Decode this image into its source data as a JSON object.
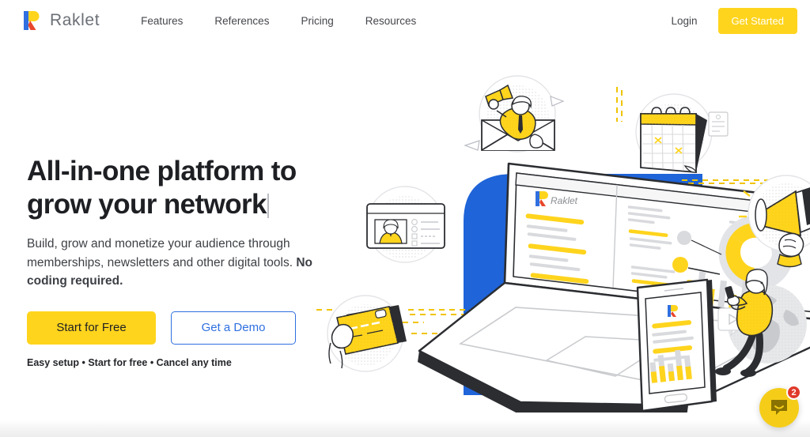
{
  "header": {
    "logo_name": "raklet-logo-icon",
    "brand": "Raklet",
    "nav": [
      {
        "label": "Features"
      },
      {
        "label": "References"
      },
      {
        "label": "Pricing"
      },
      {
        "label": "Resources"
      }
    ],
    "login": "Login",
    "get_started": "Get Started"
  },
  "hero": {
    "headline_line1": "All-in-one platform to",
    "headline_line2": "grow your  network",
    "subhead_part1": "Build, grow and monetize your audience through memberships, newsletters and other digital tools. ",
    "subhead_bold": "No coding required.",
    "cta_primary": "Start for Free",
    "cta_secondary": "Get a Demo",
    "fineprint": "Easy setup • Start for free • Cancel any time"
  },
  "illustration": {
    "alt": "Laptop and tablet showing Raklet dashboard surrounded by feature icons",
    "device_brand": "Raklet",
    "icons": [
      {
        "name": "envelope-megaphone-icon",
        "label": "Email campaigns"
      },
      {
        "name": "calendar-icon",
        "label": "Events calendar"
      },
      {
        "name": "member-card-icon",
        "label": "Member profiles"
      },
      {
        "name": "credit-card-icon",
        "label": "Payments"
      },
      {
        "name": "megaphone-icon",
        "label": "Broadcast"
      },
      {
        "name": "globe-person-icon",
        "label": "Global network"
      }
    ]
  },
  "chat": {
    "icon": "chat-bubble-icon",
    "unread_count": "2"
  },
  "colors": {
    "brand_yellow": "#ffd41d",
    "brand_blue": "#1f64d8",
    "link_blue": "#2f6fe0",
    "badge_red": "#e0392a",
    "text_dark": "#1d1f23"
  }
}
